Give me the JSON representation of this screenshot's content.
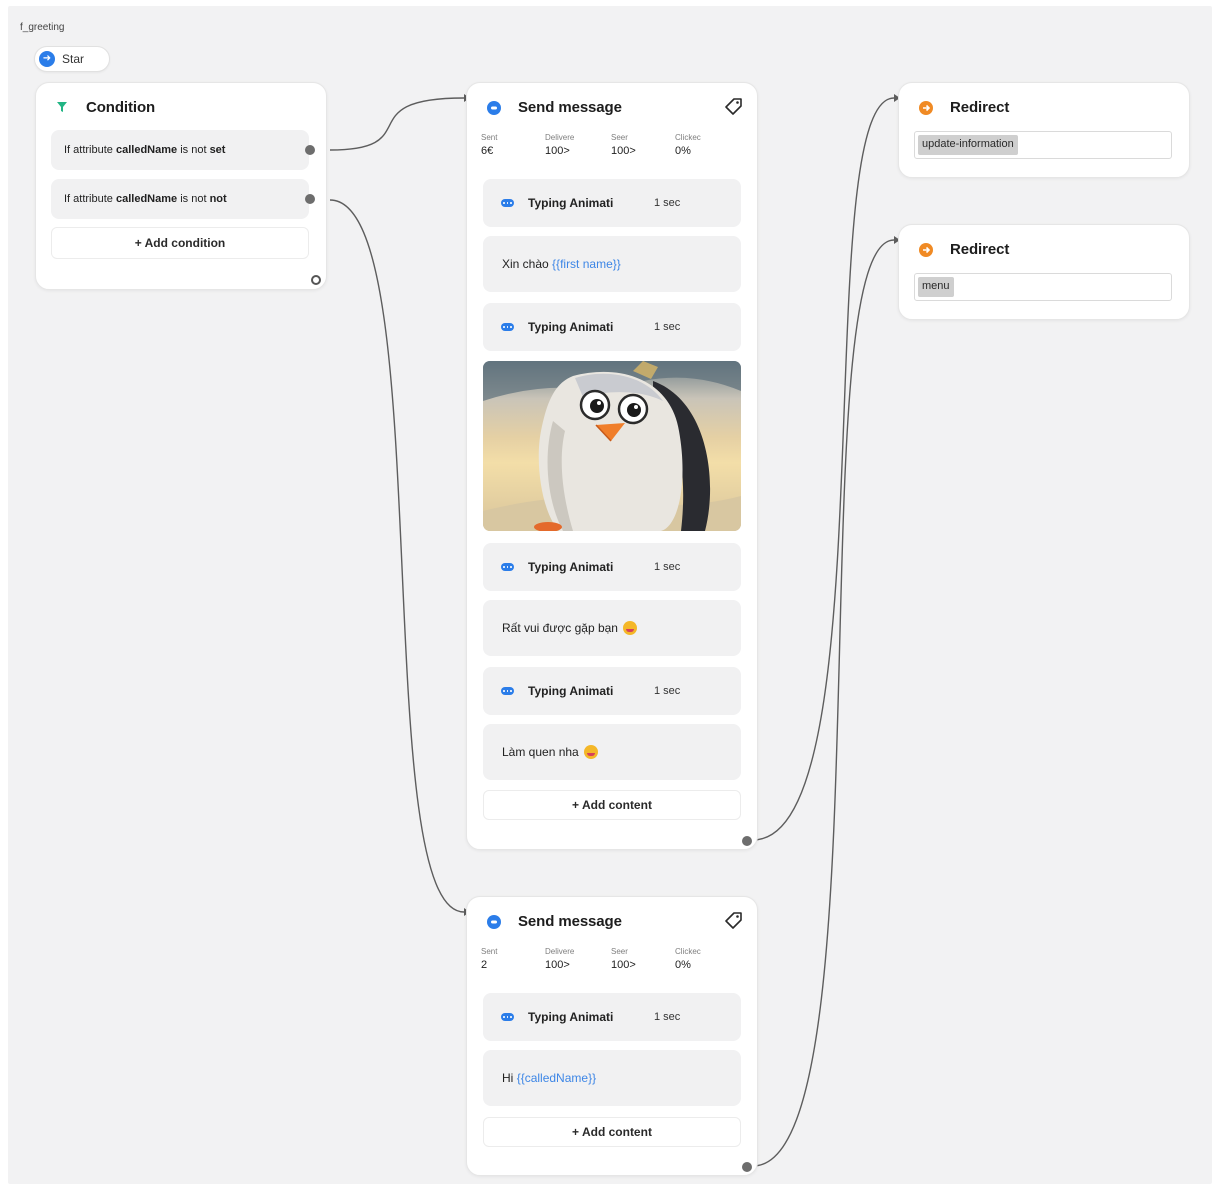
{
  "flow": {
    "name": "f_greeting"
  },
  "start": {
    "label": "Star"
  },
  "condition": {
    "title": "Condition",
    "rows": [
      {
        "prefix": "If attribute",
        "attribute": "calledName",
        "op": "is not",
        "value": "set"
      },
      {
        "prefix": "If attribute",
        "attribute": "calledName",
        "op": "is not",
        "value": "not"
      }
    ],
    "add_label": "+ Add condition"
  },
  "send1": {
    "title": "Send message",
    "stats": [
      {
        "label": "Sent",
        "value": "6€"
      },
      {
        "label": "Delivere",
        "value": "100>"
      },
      {
        "label": "Seer",
        "value": "100>"
      },
      {
        "label": "Clickec",
        "value": "0%"
      }
    ],
    "typing_label": "Typing Animati",
    "typing_duration": "1 sec",
    "msg1_text": "Xin chào ",
    "msg1_var": "{{first name}}",
    "msg2_text": "Rất vui được gặp bạn",
    "msg3_text": "Làm quen nha",
    "add_label": "+ Add content"
  },
  "send2": {
    "title": "Send message",
    "stats": [
      {
        "label": "Sent",
        "value": "2"
      },
      {
        "label": "Delivere",
        "value": "100>"
      },
      {
        "label": "Seer",
        "value": "100>"
      },
      {
        "label": "Clickec",
        "value": "0%"
      }
    ],
    "typing_label": "Typing Animati",
    "typing_duration": "1 sec",
    "msg_text": "Hi ",
    "msg_var": "{{calledName}}",
    "add_label": "+ Add content"
  },
  "redirect1": {
    "title": "Redirect",
    "target": "update-information"
  },
  "redirect2": {
    "title": "Redirect",
    "target": "menu"
  },
  "colors": {
    "accent_blue": "#2b7de9",
    "condition_green": "#22b585",
    "redirect_orange": "#f08a24",
    "variable_blue": "#3d86e6",
    "canvas_bg": "#f2f2f3"
  }
}
